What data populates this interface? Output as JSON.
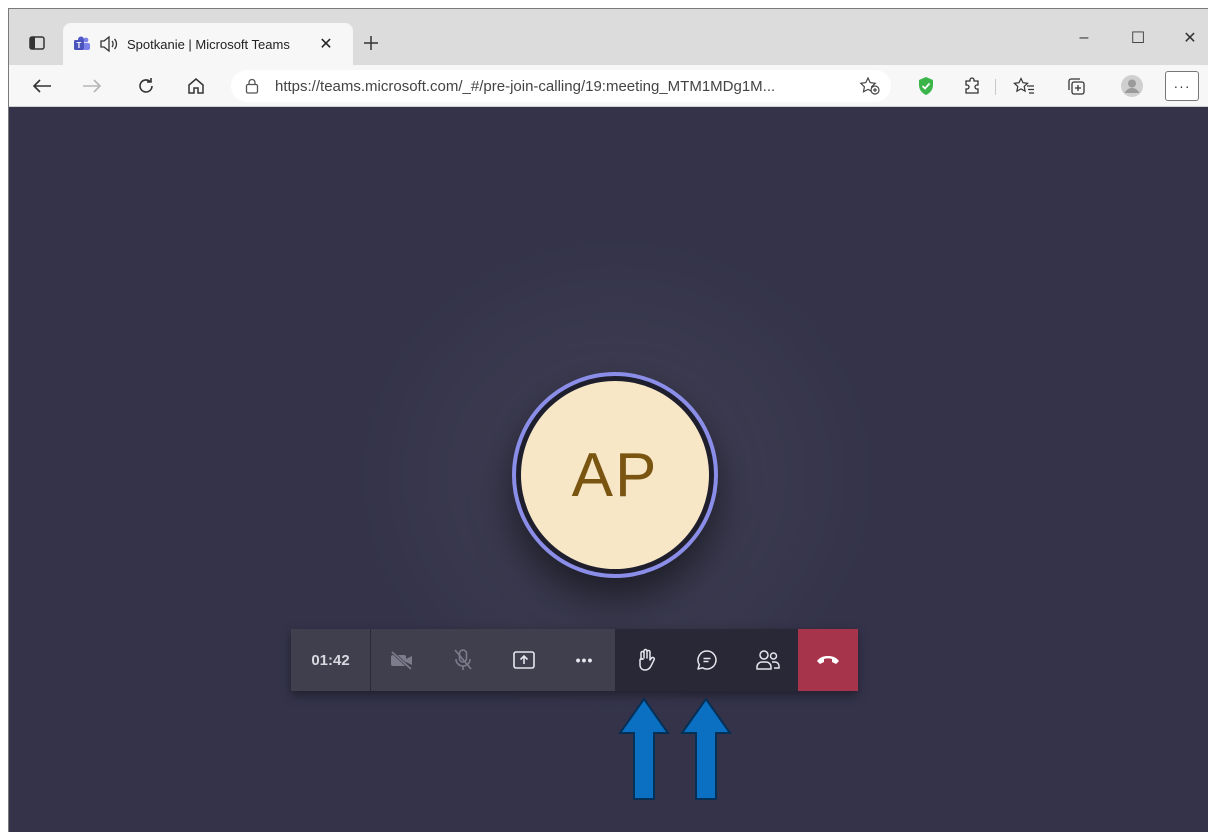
{
  "browser": {
    "tab": {
      "title": "Spotkanie | Microsoft Teams",
      "close_label": "✕"
    },
    "new_tab_label": "+",
    "window_controls": {
      "minimize": "–",
      "maximize": "☐",
      "close": "✕"
    },
    "address": {
      "url": "https://teams.microsoft.com/_#/pre-join-calling/19:meeting_MTM1MDg1M..."
    },
    "more_label": "···"
  },
  "meeting": {
    "avatar_initials": "AP",
    "timer": "01:42",
    "more_actions_label": "•••"
  },
  "colors": {
    "stage": "#34334a",
    "avatar_ring": "#8b8ee8",
    "avatar_bg": "#f7e7c7",
    "avatar_text": "#7a5512",
    "hangup": "#a6344a",
    "annotation_arrow": "#0b6fc2"
  },
  "icons": {
    "tab_actions": "tab-actions-icon",
    "teams": "teams-icon",
    "audio": "speaker-icon",
    "back": "back-arrow-icon",
    "forward": "forward-arrow-icon",
    "refresh": "refresh-icon",
    "home": "home-icon",
    "lock": "lock-icon",
    "add_favorite": "add-favorite-icon",
    "shield": "shield-icon",
    "extensions": "puzzle-icon",
    "favorites": "favorites-icon",
    "collections": "collections-icon",
    "profile": "profile-icon",
    "camera_off": "camera-off-icon",
    "mic_off": "mic-off-icon",
    "share": "share-screen-icon",
    "raise_hand": "raise-hand-icon",
    "chat": "chat-icon",
    "participants": "participants-icon",
    "hangup": "hangup-icon"
  }
}
